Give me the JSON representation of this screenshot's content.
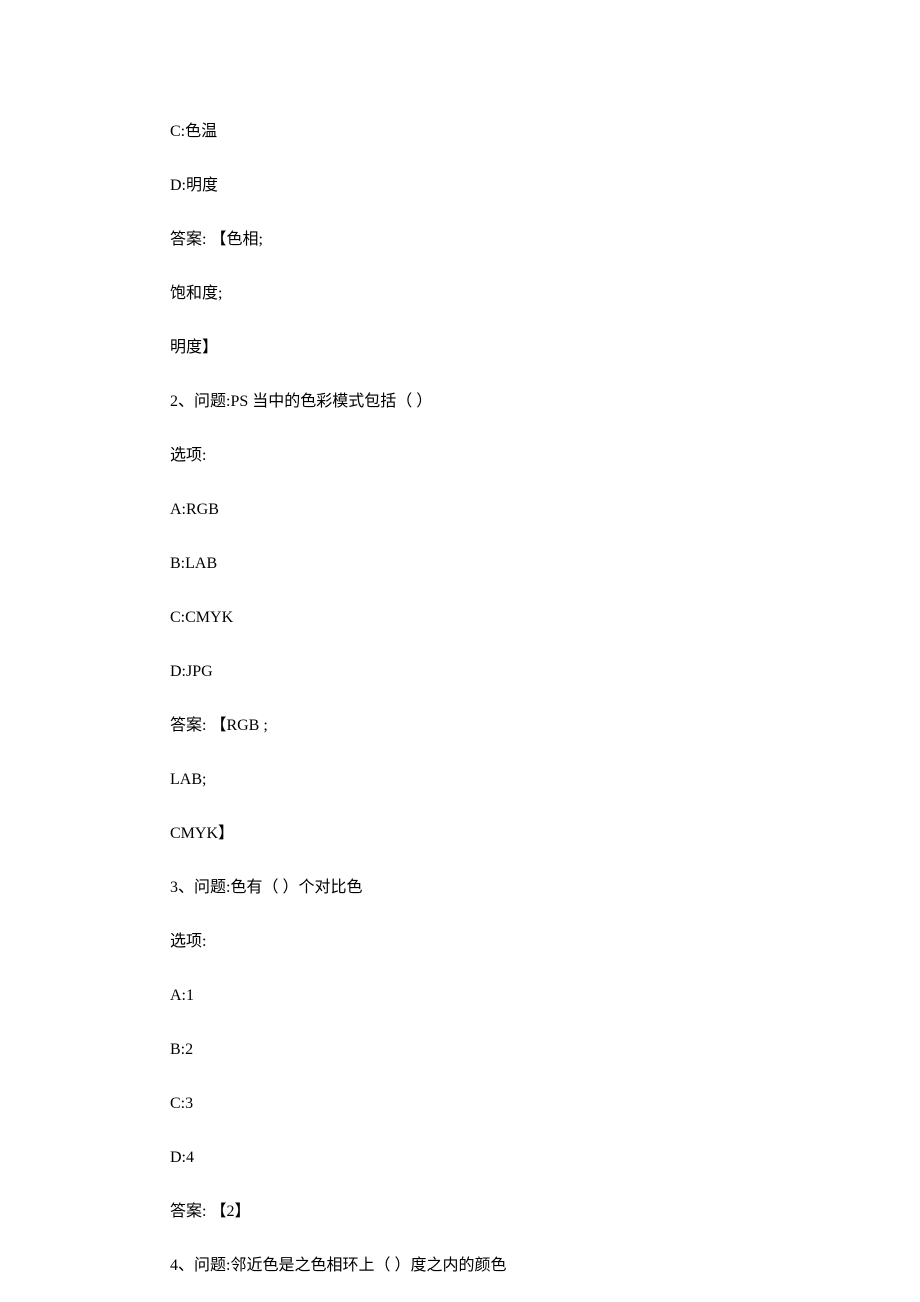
{
  "lines": [
    "C:色温",
    "D:明度",
    "答案:  【色相;",
    "饱和度;",
    "明度】",
    "2、问题:PS 当中的色彩模式包括（  ）",
    "选项:",
    "A:RGB",
    "B:LAB",
    "C:CMYK",
    "D:JPG",
    "答案:  【RGB ;",
    "LAB;",
    "CMYK】",
    "3、问题:色有（  ）个对比色",
    "选项:",
    "A:1",
    "B:2",
    "C:3",
    "D:4",
    "答案:  【2】",
    "4、问题:邻近色是之色相环上（  ）度之内的颜色"
  ]
}
